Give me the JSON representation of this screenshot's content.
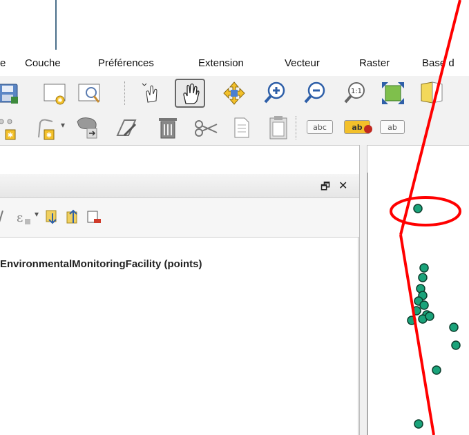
{
  "menu": {
    "items": [
      "e",
      "Couche",
      "Préférences",
      "Extension",
      "Vecteur",
      "Raster",
      "Base d"
    ]
  },
  "toolbar": {
    "icons": [
      "save-icon",
      "new-print-layout-icon",
      "layout-manager-icon",
      "touch-zoom-icon",
      "pan-icon",
      "pan-to-selection-icon",
      "zoom-in-icon",
      "zoom-out-icon",
      "zoom-native-icon",
      "zoom-full-icon",
      "identify-icon"
    ],
    "digitize_icons": [
      "add-point-icon",
      "vertex-tool-icon",
      "reshape-icon",
      "node-edit-icon",
      "delete-selected-icon",
      "cut-features-icon",
      "copy-features-icon",
      "paste-features-icon"
    ],
    "label_buttons": [
      "abc",
      "ab",
      "ab"
    ]
  },
  "layers_panel": {
    "header_buttons": [
      "float-icon",
      "close-icon"
    ],
    "float_label": "🗗",
    "close_label": "✕",
    "layer_name": "EnvironmentalMonitoringFacility (points)"
  },
  "map": {
    "point_color": "#1aa37a",
    "annotation_color": "#ff0000"
  }
}
